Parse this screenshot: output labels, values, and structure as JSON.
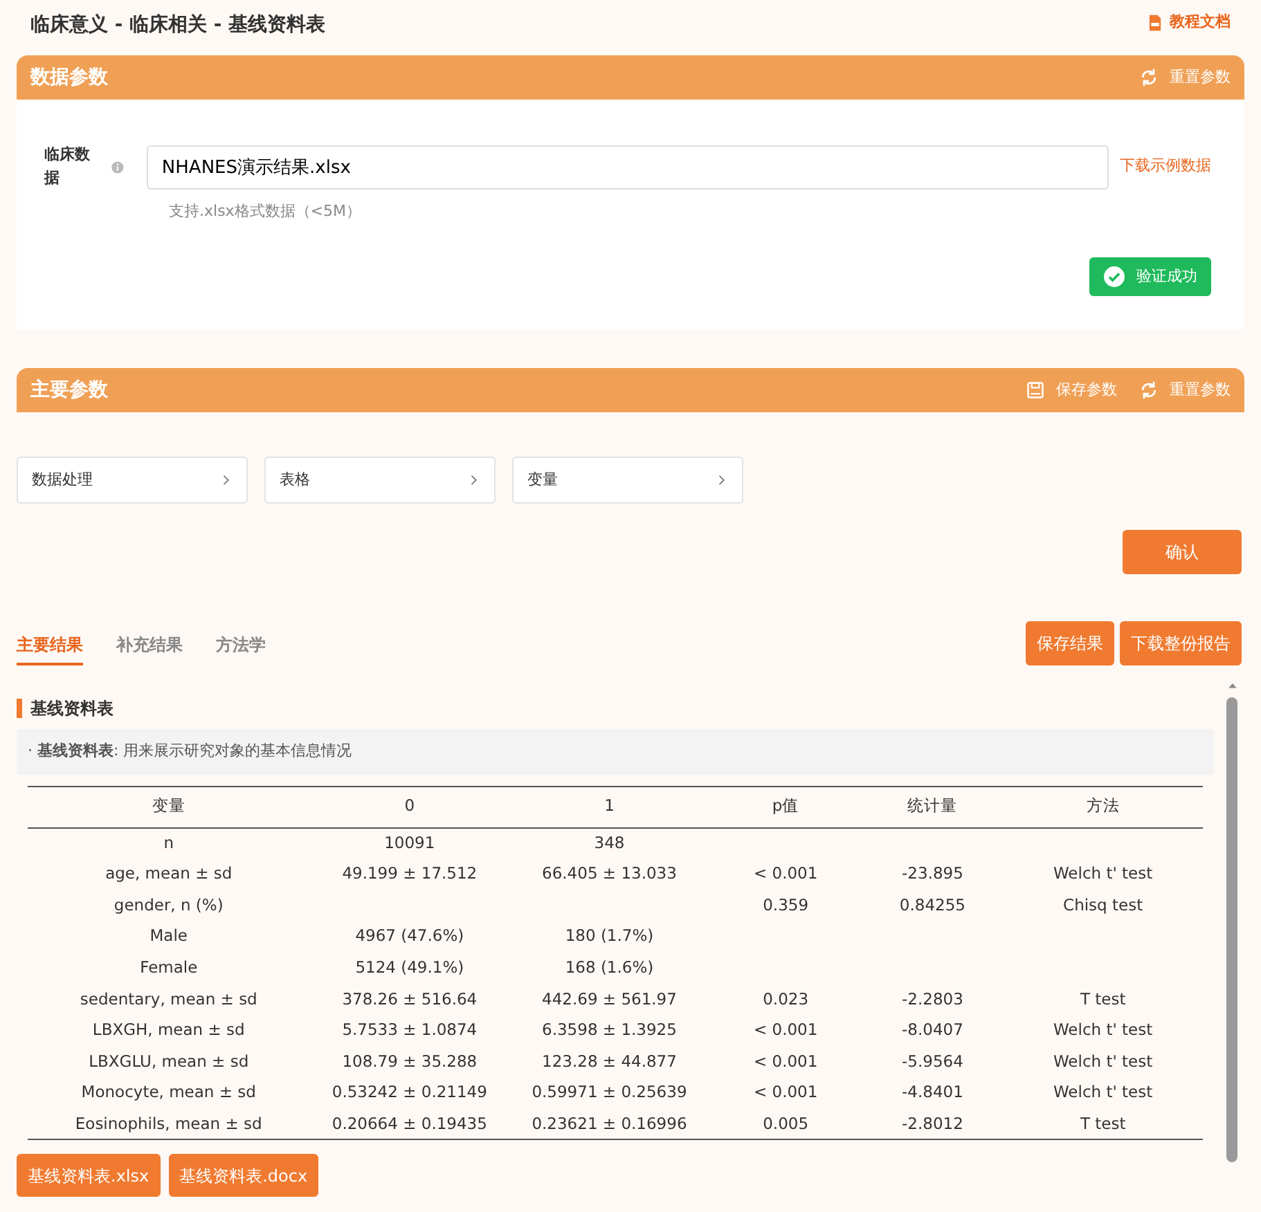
{
  "page_title": "临床意义 - 临床相关 - 基线资料表",
  "doc_link": "教程文档",
  "data_panel": {
    "title": "数据参数",
    "reset": "重置参数",
    "field_label": "临床数据",
    "file_value": "NHANES演示结果.xlsx",
    "download_sample": "下载示例数据",
    "hint": "支持.xlsx格式数据（<5M）",
    "verify_button": "验证成功"
  },
  "main_panel": {
    "title": "主要参数",
    "save": "保存参数",
    "reset": "重置参数",
    "sections": [
      {
        "label": "数据处理",
        "expanded": false
      },
      {
        "label": "表格",
        "expanded": false
      },
      {
        "label": "变量",
        "expanded": false
      }
    ],
    "confirm": "确认"
  },
  "result_tabs": [
    {
      "label": "主要结果",
      "selected": true
    },
    {
      "label": "补充结果",
      "selected": false
    },
    {
      "label": "方法学",
      "selected": false
    }
  ],
  "result_buttons": [
    "保存结果",
    "下载整份报告"
  ],
  "section_title": "基线资料表",
  "description": "· **基线资料表**: 用来展示研究对象的基本信息情况",
  "table": {
    "columns": [
      "变量",
      "0",
      "1",
      "p值",
      "统计量",
      "方法"
    ],
    "rows": [
      [
        "n",
        "10091",
        "348",
        "",
        "",
        ""
      ],
      [
        "age, mean ± sd",
        "49.199 ± 17.512",
        "66.405 ± 13.033",
        "< 0.001",
        "-23.895",
        "Welch t' test"
      ],
      [
        "gender, n (%)",
        "",
        "",
        "0.359",
        "0.84255",
        "Chisq test"
      ],
      [
        "Male",
        "4967 (47.6%)",
        "180 (1.7%)",
        "",
        "",
        ""
      ],
      [
        "Female",
        "5124 (49.1%)",
        "168 (1.6%)",
        "",
        "",
        ""
      ],
      [
        "sedentary, mean ± sd",
        "378.26 ± 516.64",
        "442.69 ± 561.97",
        "0.023",
        "-2.2803",
        "T test"
      ],
      [
        "LBXGH, mean ± sd",
        "5.7533 ± 1.0874",
        "6.3598 ± 1.3925",
        "< 0.001",
        "-8.0407",
        "Welch t' test"
      ],
      [
        "LBXGLU, mean ± sd",
        "108.79 ± 35.288",
        "123.28 ± 44.877",
        "< 0.001",
        "-5.9564",
        "Welch t' test"
      ],
      [
        "Monocyte, mean ± sd",
        "0.53242 ± 0.21149",
        "0.59971 ± 0.25639",
        "< 0.001",
        "-4.8401",
        "Welch t' test"
      ],
      [
        "Eosinophils, mean ± sd",
        "0.20664 ± 0.19435",
        "0.23621 ± 0.16996",
        "0.005",
        "-2.8012",
        "T test"
      ]
    ]
  },
  "downloads": [
    "基线资料表.xlsx",
    "基线资料表.docx"
  ]
}
